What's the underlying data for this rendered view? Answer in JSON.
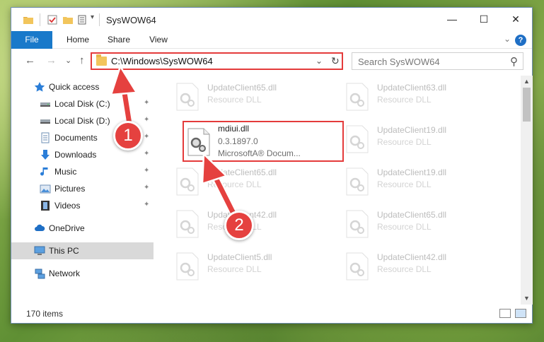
{
  "window": {
    "title": "SysWOW64",
    "controls": {
      "minimize": "—",
      "maximize": "☐",
      "close": "✕"
    }
  },
  "ribbon": {
    "tabs": [
      "File",
      "Home",
      "Share",
      "View"
    ],
    "help": "?",
    "collapse": "⌄"
  },
  "nav": {
    "back": "←",
    "forward": "→",
    "recent": "⌄",
    "up": "↑",
    "address": "C:\\Windows\\SysWOW64",
    "address_dropdown": "⌄",
    "refresh": "↻",
    "search_placeholder": "Search SysWOW64",
    "search_icon": "⚲"
  },
  "sidebar": {
    "items": [
      {
        "label": "Quick access",
        "icon": "star-icon",
        "pinned": false
      },
      {
        "label": "Local Disk (C:)",
        "icon": "drive-icon",
        "pinned": true
      },
      {
        "label": "Local Disk (D:)",
        "icon": "drive-icon",
        "pinned": true
      },
      {
        "label": "Documents",
        "icon": "documents-icon",
        "pinned": true
      },
      {
        "label": "Downloads",
        "icon": "download-icon",
        "pinned": true
      },
      {
        "label": "Music",
        "icon": "music-icon",
        "pinned": true
      },
      {
        "label": "Pictures",
        "icon": "pictures-icon",
        "pinned": true
      },
      {
        "label": "Videos",
        "icon": "videos-icon",
        "pinned": true
      },
      {
        "label": "OneDrive",
        "icon": "cloud-icon",
        "pinned": false
      },
      {
        "label": "This PC",
        "icon": "computer-icon",
        "pinned": false,
        "selected": true
      },
      {
        "label": "Network",
        "icon": "network-icon",
        "pinned": false
      }
    ],
    "pin_glyph": "📌"
  },
  "files": [
    {
      "name": "UpdateClient65.dll",
      "type": "Resource DLL",
      "faded": true
    },
    {
      "name": "UpdateClient63.dll",
      "type": "Resource DLL",
      "faded": true
    },
    {
      "name": "mdiui.dll",
      "type": "0.3.1897.0",
      "desc": "MicrosoftA® Docum...",
      "highlighted": true
    },
    {
      "name": "UpdateClient19.dll",
      "type": "Resource DLL",
      "faded": true
    },
    {
      "name": "UpdateClient65.dll",
      "type": "Resource DLL",
      "faded": true
    },
    {
      "name": "UpdateClient19.dll",
      "type": "Resource DLL",
      "faded": true
    },
    {
      "name": "UpdateClient42.dll",
      "type": "Resource DLL",
      "faded": true
    },
    {
      "name": "UpdateClient65.dll",
      "type": "Resource DLL",
      "faded": true
    },
    {
      "name": "UpdateClient5.dll",
      "type": "Resource DLL",
      "faded": true
    },
    {
      "name": "UpdateClient42.dll",
      "type": "Resource DLL",
      "faded": true
    }
  ],
  "status": {
    "item_count": "170 items"
  },
  "callouts": [
    {
      "number": "1",
      "color": "#e5413f"
    },
    {
      "number": "2",
      "color": "#e5413f"
    }
  ],
  "colors": {
    "accent": "#1979ca",
    "highlight": "#e43b3b",
    "selected_bg": "#d9d9d9"
  }
}
